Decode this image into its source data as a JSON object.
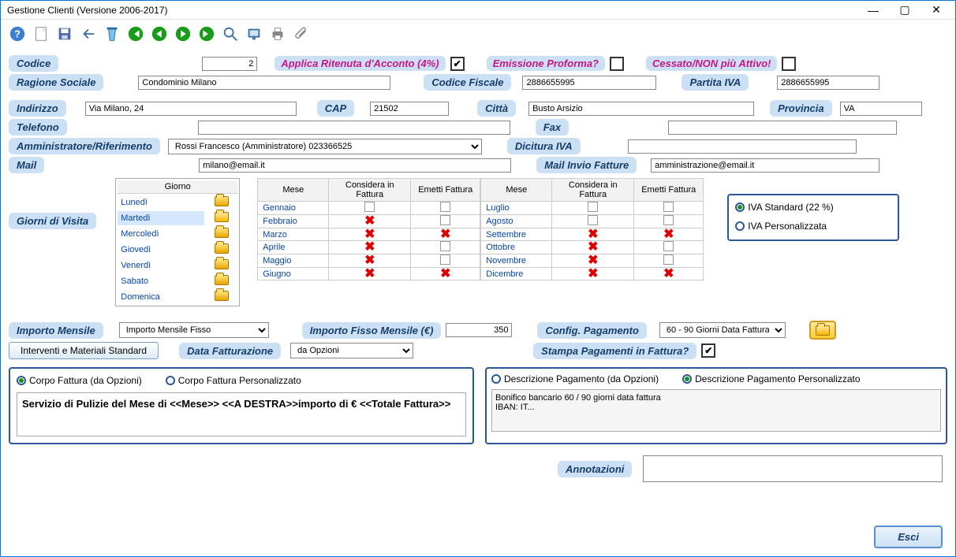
{
  "window": {
    "title": "Gestione Clienti (Versione 2006-2017)"
  },
  "labels": {
    "codice": "Codice",
    "applica_ritenuta": "Applica Ritenuta d'Acconto (4%)",
    "emissione_proforma": "Emissione Proforma?",
    "cessato": "Cessato/NON più Attivo!",
    "ragione_sociale": "Ragione Sociale",
    "codice_fiscale": "Codice Fiscale",
    "partita_iva": "Partita IVA",
    "indirizzo": "Indirizzo",
    "cap": "CAP",
    "citta": "Città",
    "provincia": "Provincia",
    "telefono": "Telefono",
    "fax": "Fax",
    "amm_rif": "Amministratore/Riferimento",
    "dicitura_iva": "Dicitura IVA",
    "mail": "Mail",
    "mail_fatture": "Mail Invio Fatture",
    "giorni_visita": "Giorni di Visita",
    "importo_mensile": "Importo Mensile",
    "importo_fisso": "Importo Fisso Mensile (€)",
    "config_pagamento": "Config. Pagamento",
    "interventi": "Interventi e Materiali Standard",
    "data_fatturazione": "Data Fatturazione",
    "stampa_pagamenti": "Stampa Pagamenti in Fattura?",
    "annotazioni": "Annotazioni",
    "esci": "Esci",
    "corpo_opzioni": "Corpo Fattura (da Opzioni)",
    "corpo_personalizzato": "Corpo Fattura Personalizzato",
    "descr_pag_opzioni": "Descrizione Pagamento (da Opzioni)",
    "descr_pag_pers": "Descrizione Pagamento Personalizzato",
    "iva_standard": "IVA Standard (22 %)",
    "iva_personalizzata": "IVA Personalizzata"
  },
  "fields": {
    "codice": "2",
    "ragione_sociale": "Condominio Milano",
    "codice_fiscale": "2886655995",
    "partita_iva": "2886655995",
    "indirizzo": "Via Milano, 24",
    "cap": "21502",
    "citta": "Busto Arsizio",
    "provincia": "VA",
    "telefono": "",
    "fax": "",
    "amm_rif": "Rossi Francesco (Amministratore) 023366525",
    "dicitura_iva": "",
    "mail": "milano@email.it",
    "mail_fatture": "amministrazione@email.it",
    "importo_mensile_tipo": "Importo Mensile Fisso",
    "importo_fisso_val": "350",
    "config_pagamento": "60 - 90 Giorni Data Fattura",
    "data_fatturazione": "da Opzioni",
    "annotazioni": ""
  },
  "checks": {
    "applica_ritenuta": true,
    "emissione_proforma": false,
    "cessato": false,
    "stampa_pagamenti": true
  },
  "days_header": "Giorno",
  "days": [
    "Lunedì",
    "Martedì",
    "Mercoledì",
    "Giovedì",
    "Venerdì",
    "Sabato",
    "Domenica"
  ],
  "days_selected": "Martedì",
  "months_headers": {
    "mese": "Mese",
    "considera": "Considera in Fattura",
    "emetti": "Emetti Fattura"
  },
  "months_left": [
    {
      "name": "Gennaio",
      "considera": "chk",
      "emetti": "chk"
    },
    {
      "name": "Febbraio",
      "considera": "x",
      "emetti": "chk"
    },
    {
      "name": "Marzo",
      "considera": "x",
      "emetti": "x"
    },
    {
      "name": "Aprile",
      "considera": "x",
      "emetti": "chk"
    },
    {
      "name": "Maggio",
      "considera": "x",
      "emetti": "chk"
    },
    {
      "name": "Giugno",
      "considera": "x",
      "emetti": "x"
    }
  ],
  "months_right": [
    {
      "name": "Luglio",
      "considera": "chk",
      "emetti": "chk"
    },
    {
      "name": "Agosto",
      "considera": "chk",
      "emetti": "chk"
    },
    {
      "name": "Settembre",
      "considera": "x",
      "emetti": "x"
    },
    {
      "name": "Ottobre",
      "considera": "x",
      "emetti": "chk"
    },
    {
      "name": "Novembre",
      "considera": "x",
      "emetti": "chk"
    },
    {
      "name": "Dicembre",
      "considera": "x",
      "emetti": "x"
    }
  ],
  "body_text": "Servizio di Pulizie del Mese di <<Mese>> <<A DESTRA>>importo di € <<Totale Fattura>>",
  "pay_text": "Bonifico bancario 60 / 90 giorni data fattura\nIBAN: IT..."
}
